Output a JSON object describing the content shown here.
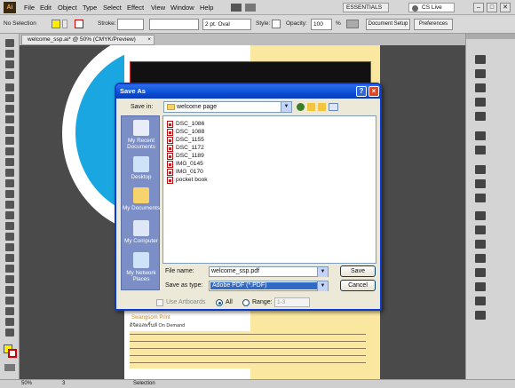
{
  "app": {
    "logo": "Ai",
    "menu": [
      "File",
      "Edit",
      "Object",
      "Type",
      "Select",
      "Effect",
      "View",
      "Window",
      "Help"
    ],
    "workspace": "ESSENTIALS",
    "search_label": "CS Live",
    "window_buttons": [
      "–",
      "□",
      "✕"
    ]
  },
  "control_bar": {
    "selection": "No Selection",
    "stroke_label": "Stroke:",
    "brush": "2 pt. Oval",
    "style_label": "Style:",
    "opacity_label": "Opacity:",
    "opacity_value": "100",
    "opacity_unit": "%",
    "document_setup": "Document Setup",
    "preferences": "Preferences"
  },
  "document_tab": "welcome_ssp.ai* @ 50% (CMYK/Preview)",
  "canvas": {
    "thai_line1": "Swangsom Print",
    "body_text": "ดิจิตอลพริ้นท์ On Demand"
  },
  "status": {
    "zoom": "50%",
    "page": "3",
    "mode": "Selection"
  },
  "dialog": {
    "title": "Save As",
    "save_in_label": "Save in:",
    "save_in_value": "welcome page",
    "places": [
      "My Recent Documents",
      "Desktop",
      "My Documents",
      "My Computer",
      "My Network Places"
    ],
    "files": [
      "DSC_1086",
      "DSC_1088",
      "DSC_1155",
      "DSC_1172",
      "DSC_1189",
      "IMG_0145",
      "IMG_0170",
      "pocket book"
    ],
    "file_name_label": "File name:",
    "file_name_value": "welcome_ssp.pdf",
    "save_type_label": "Save as type:",
    "save_type_value": "Adobe PDF (*.PDF)",
    "save_button": "Save",
    "cancel_button": "Cancel",
    "use_artboards": "Use Artboards",
    "all_label": "All",
    "range_label": "Range:",
    "range_value": "1-3"
  },
  "colors": {
    "title_blue": "#0a4fd8",
    "selection_blue": "#316ac5",
    "canvas_cyan": "#1aa6e0",
    "paper_yellow": "#fbe8a0"
  }
}
